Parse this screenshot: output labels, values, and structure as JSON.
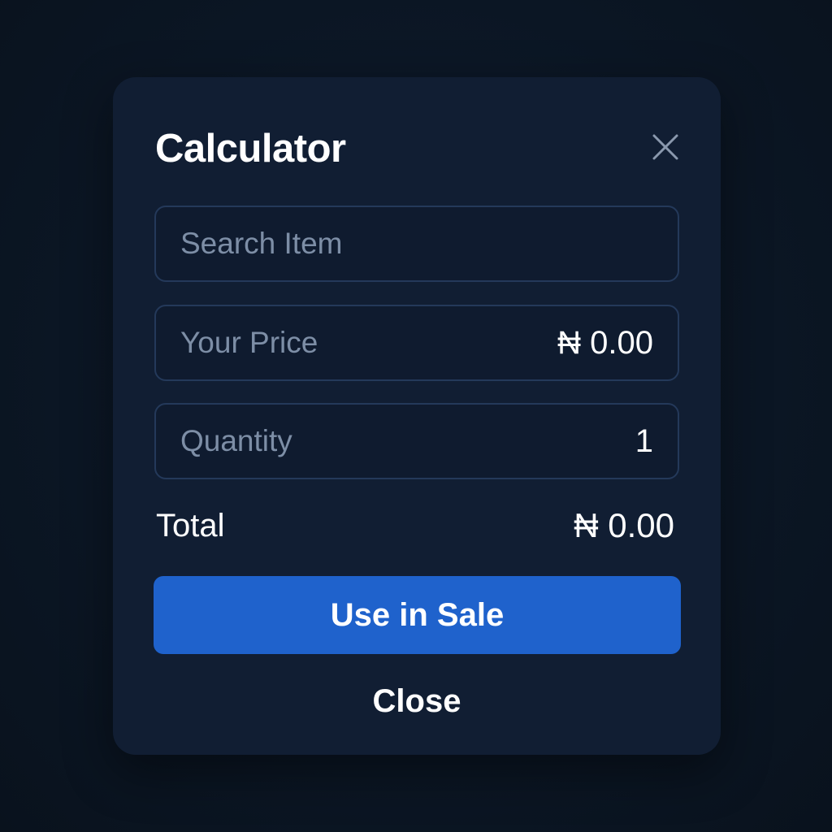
{
  "dialog": {
    "title": "Calculator",
    "close_icon": "close-x-icon"
  },
  "search": {
    "placeholder": "Search Item",
    "value": ""
  },
  "price": {
    "label": "Your Price",
    "value": "₦ 0.00"
  },
  "quantity": {
    "label": "Quantity",
    "value": "1"
  },
  "total": {
    "label": "Total",
    "value": "₦ 0.00"
  },
  "actions": {
    "primary_label": "Use in Sale",
    "secondary_label": "Close"
  },
  "colors": {
    "background": "#0b1625",
    "dialog": "#111e33",
    "field_border": "#24395a",
    "placeholder": "#7d8ea6",
    "accent": "#1f62cc",
    "text": "#ffffff"
  }
}
